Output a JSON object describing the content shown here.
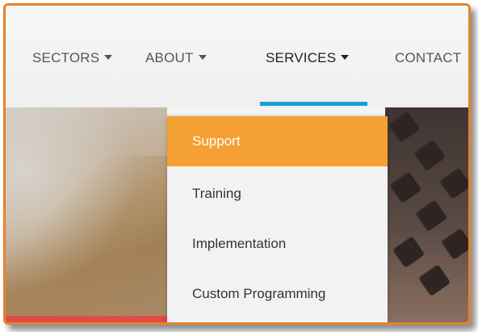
{
  "nav": {
    "items": [
      {
        "label": "SECTORS",
        "has_caret": true
      },
      {
        "label": "ABOUT",
        "has_caret": true
      },
      {
        "label": "SERVICES",
        "has_caret": true,
        "active": true
      },
      {
        "label": "CONTACT",
        "has_caret": false
      }
    ]
  },
  "dropdown": {
    "items": [
      {
        "label": "Support",
        "selected": true
      },
      {
        "label": "Training"
      },
      {
        "label": "Implementation"
      },
      {
        "label": "Custom Programming"
      }
    ]
  },
  "colors": {
    "frame_border": "#e8822a",
    "active_underline": "#1a9fd8",
    "selected_item_bg": "#f5a033",
    "accent_bar": "#e14b46"
  },
  "icons": {
    "caret": "caret-down-icon"
  }
}
